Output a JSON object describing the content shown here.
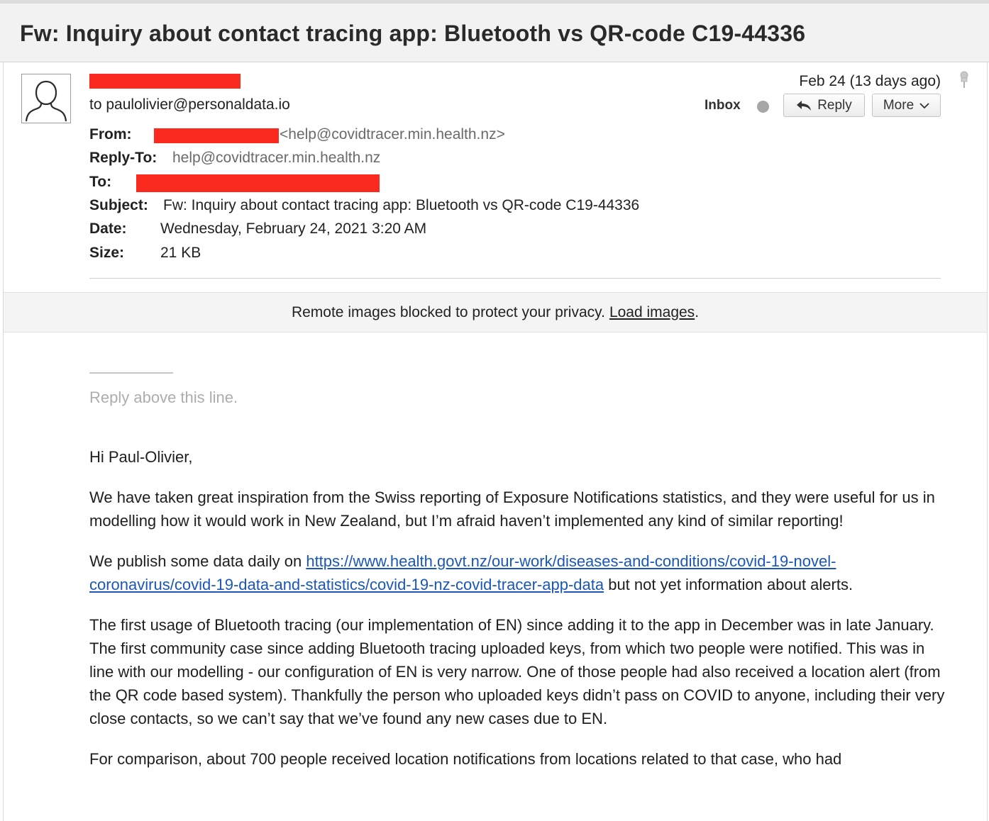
{
  "email": {
    "subject": "Fw: Inquiry about contact tracing app: Bluetooth vs QR-code C19-44336",
    "to_line": "to paulolivier@personaldata.io",
    "date_short": "Feb 24 (13 days ago)",
    "folder": "Inbox",
    "reply_label": "Reply",
    "more_label": "More",
    "headers": {
      "from_label": "From:",
      "from_value": "<help@covidtracer.min.health.nz>",
      "reply_to_label": "Reply-To:",
      "reply_to_value": "help@covidtracer.min.health.nz",
      "to_label": "To:",
      "subject_label": "Subject:",
      "subject_value": "Fw: Inquiry about contact tracing app: Bluetooth vs QR-code C19-44336",
      "date_label": "Date:",
      "date_value": "Wednesday, February 24, 2021 3:20 AM",
      "size_label": "Size:",
      "size_value": "21 KB"
    },
    "images_notice": "Remote images blocked to protect your privacy.",
    "load_images": "Load images",
    "load_images_suffix": ".",
    "reply_above": "Reply above this line.",
    "body": {
      "greeting": "Hi Paul-Olivier,",
      "p1": "We have taken great inspiration from the Swiss reporting of Exposure Notifications statistics, and they were useful for us in modelling how it would work in New Zealand, but I’m afraid haven’t implemented any kind of similar reporting!",
      "p2_before": "We publish some data daily on ",
      "p2_link": "https://www.health.govt.nz/our-work/diseases-and-conditions/covid-19-novel-coronavirus/covid-19-data-and-statistics/covid-19-nz-covid-tracer-app-data",
      "p2_after": " but not yet information about alerts.",
      "p3": "The first usage of Bluetooth tracing (our implementation of EN) since adding it to the app in December was in late January. The first community case since adding Bluetooth tracing uploaded keys, from which two people were notified. This was in line with our modelling - our configuration of EN is very narrow. One of those people had also received a location alert (from the QR code based system). Thankfully the person who uploaded keys didn’t pass on COVID to anyone, including their very close contacts, so we can’t say that we’ve found any new cases due to EN.",
      "p4": "For comparison, about 700 people received location notifications from locations related to that case, who had"
    }
  },
  "colors": {
    "redaction": "#fa2a1e",
    "link": "#1a57b8",
    "subject_bar": "#f2f2f2"
  },
  "icons": [
    "avatar-silhouette-icon",
    "pin-icon",
    "status-dot-icon",
    "reply-arrow-icon",
    "chevron-down-icon"
  ]
}
